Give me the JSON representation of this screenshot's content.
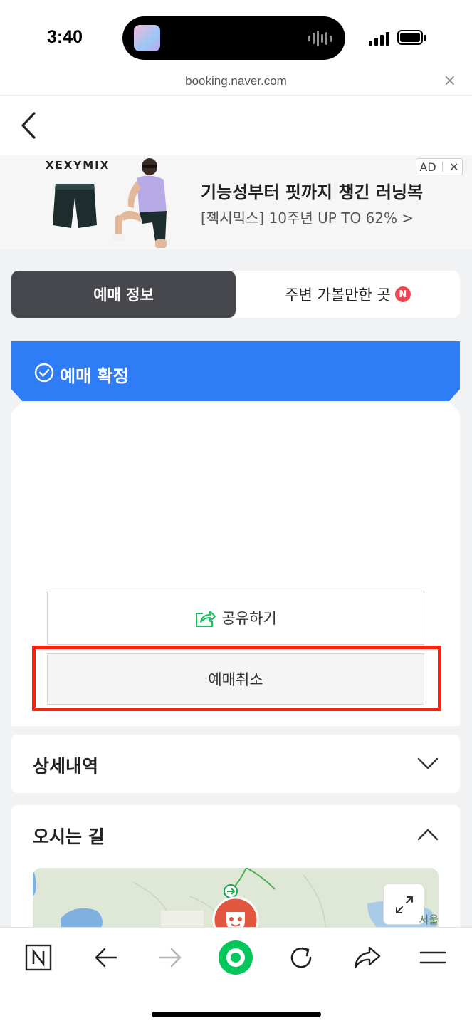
{
  "status_bar": {
    "time": "3:40"
  },
  "browser": {
    "url": "booking.naver.com",
    "close_label": "×"
  },
  "ad": {
    "brand": "XEXYMIX",
    "title": "기능성부터 핏까지 챙긴 러닝복",
    "subtitle": "[젝시믹스] 10주년 UP TO 62% >",
    "tag_label": "AD",
    "tag_close": "✕"
  },
  "tabs": {
    "active_label": "예매 정보",
    "nearby_label": "주변 가볼만한 곳",
    "new_badge": "N"
  },
  "booking": {
    "status_label": "예매 확정",
    "share_label": "공유하기",
    "cancel_label": "예매취소"
  },
  "sections": {
    "details_title": "상세내역",
    "directions_title": "오시는 길"
  },
  "map": {
    "label": "서울"
  },
  "colors": {
    "accent_blue": "#2e7cf6",
    "highlight_red": "#f8220f",
    "tab_dark": "#47484d",
    "badge_red": "#f04452",
    "naver_green": "#03c75a"
  }
}
